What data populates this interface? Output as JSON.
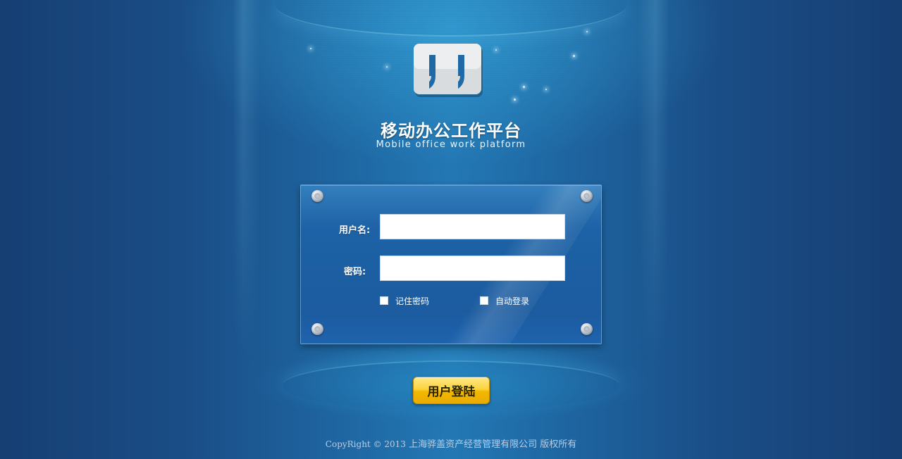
{
  "header": {
    "title": "移动办公工作平台",
    "subtitle": "Mobile office work platform",
    "logo_icon": "quote-logo-icon"
  },
  "login": {
    "username_label": "用户名:",
    "username_value": "",
    "password_label": "密码:",
    "password_value": "",
    "remember_label": "记住密码",
    "auto_login_label": "自动登录",
    "submit_label": "用户登陆"
  },
  "footer": {
    "copyright_prefix": "CopyRight © 2013",
    "copyright_company": "上海骅盖资产经营管理有限公司 版权所有"
  },
  "colors": {
    "background": "#163f73",
    "panel": "#1d5c9f",
    "button": "#fcd43c"
  }
}
